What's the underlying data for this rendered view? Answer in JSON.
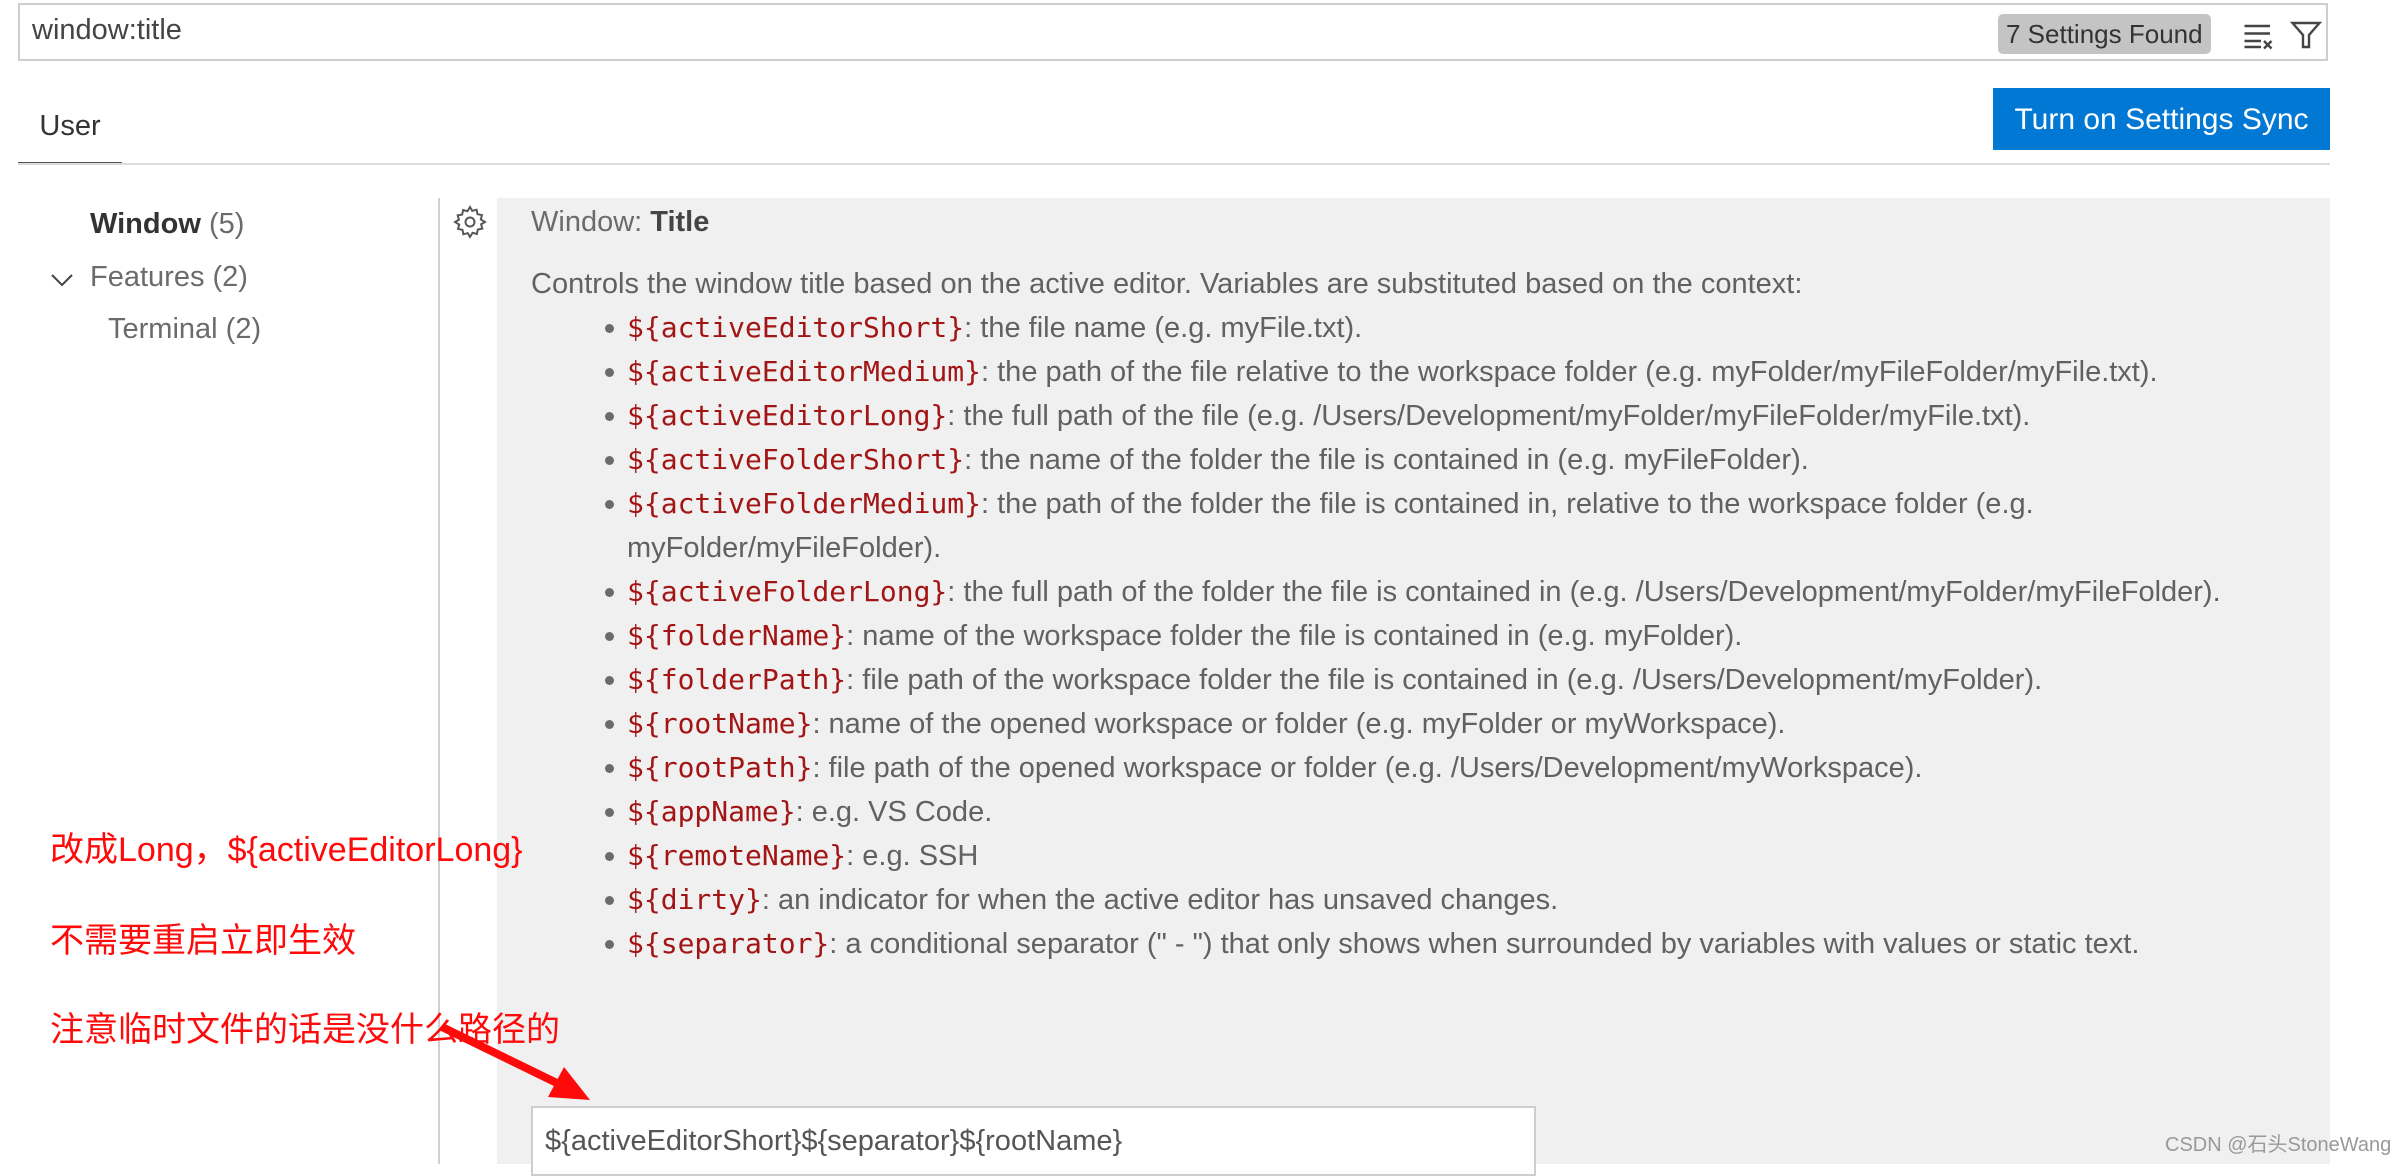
{
  "search": {
    "value": "window:title",
    "results_badge": "7 Settings Found",
    "clear_icon": "clear-filter-icon",
    "filter_icon": "filter-icon"
  },
  "tabs": [
    {
      "label": "User"
    }
  ],
  "sync_button": "Turn on Settings Sync",
  "tree": [
    {
      "label": "Window",
      "count": "(5)",
      "selected": true
    },
    {
      "label": "Features",
      "count": "(2)",
      "expanded": true
    },
    {
      "label": "Terminal",
      "count": "(2)"
    }
  ],
  "setting": {
    "category": "Window: ",
    "name": "Title",
    "description": "Controls the window title based on the active editor. Variables are substituted based on the context:",
    "items": [
      {
        "code": "${activeEditorShort}",
        "text": ": the file name (e.g. myFile.txt)."
      },
      {
        "code": "${activeEditorMedium}",
        "text": ": the path of the file relative to the workspace folder (e.g. myFolder/myFileFolder/myFile.txt)."
      },
      {
        "code": "${activeEditorLong}",
        "text": ": the full path of the file (e.g. /Users/Development/myFolder/myFileFolder/myFile.txt)."
      },
      {
        "code": "${activeFolderShort}",
        "text": ": the name of the folder the file is contained in (e.g. myFileFolder)."
      },
      {
        "code": "${activeFolderMedium}",
        "text": ": the path of the folder the file is contained in, relative to the workspace folder (e.g. myFolder/myFileFolder)."
      },
      {
        "code": "${activeFolderLong}",
        "text": ": the full path of the folder the file is contained in (e.g. /Users/Development/myFolder/myFileFolder)."
      },
      {
        "code": "${folderName}",
        "text": ": name of the workspace folder the file is contained in (e.g. myFolder)."
      },
      {
        "code": "${folderPath}",
        "text": ": file path of the workspace folder the file is contained in (e.g. /Users/Development/myFolder)."
      },
      {
        "code": "${rootName}",
        "text": ": name of the opened workspace or folder (e.g. myFolder or myWorkspace)."
      },
      {
        "code": "${rootPath}",
        "text": ": file path of the opened workspace or folder (e.g. /Users/Development/myWorkspace)."
      },
      {
        "code": "${appName}",
        "text": ": e.g. VS Code."
      },
      {
        "code": "${remoteName}",
        "text": ": e.g. SSH"
      },
      {
        "code": "${dirty}",
        "text": ": an indicator for when the active editor has unsaved changes."
      },
      {
        "code": "${separator}",
        "text": ": a conditional separator (\" - \") that only shows when surrounded by variables with values or static text."
      }
    ],
    "value": "${activeEditorShort}${separator}${rootName}"
  },
  "annotations": [
    "改成Long，${activeEditorLong}",
    "不需要重启立即生效",
    "注意临时文件的话是没什么路径的"
  ],
  "annotation_color": "#ff0a0a",
  "accent_color": "#0078d4",
  "watermark": "CSDN @石头StoneWang"
}
